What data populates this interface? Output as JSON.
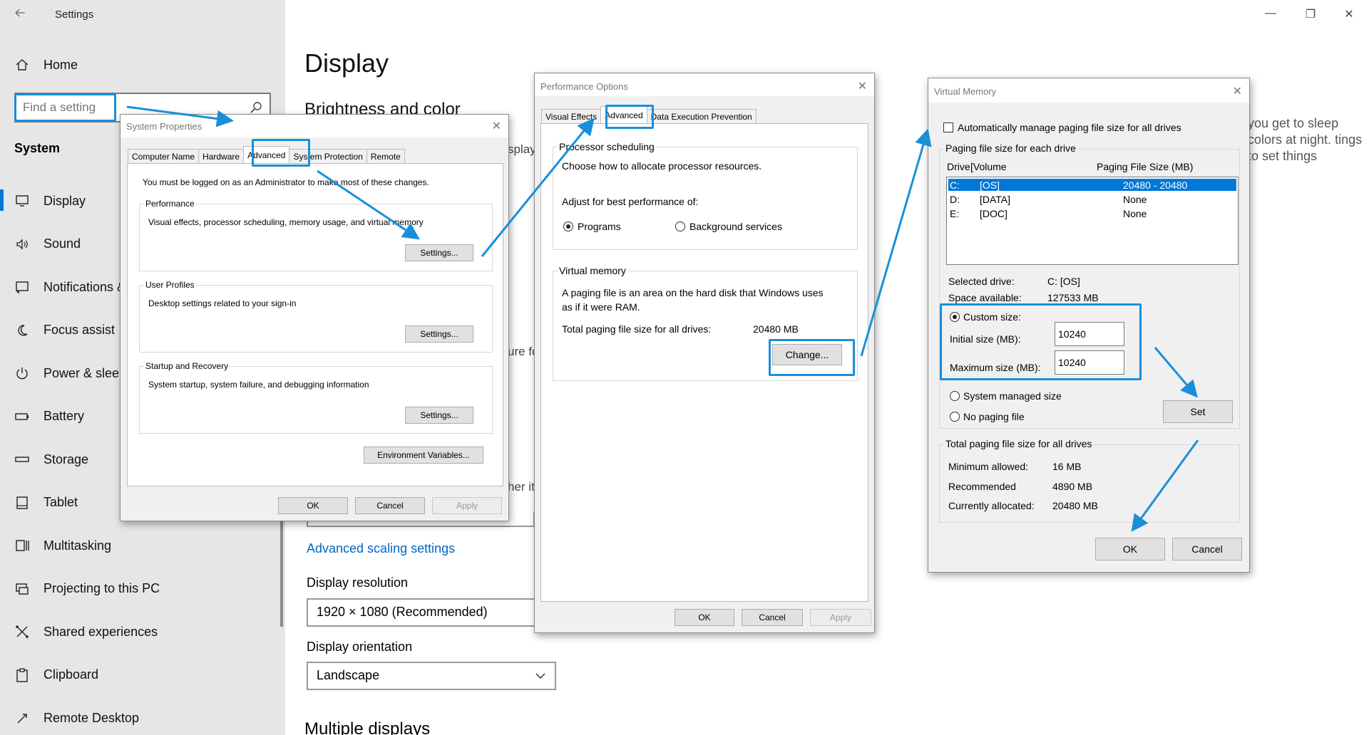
{
  "settings": {
    "title": "Settings",
    "home": "Home",
    "search_placeholder": "Find a setting",
    "category": "System",
    "nav": [
      "Display",
      "Sound",
      "Notifications &",
      "Focus assist",
      "Power & sleep",
      "Battery",
      "Storage",
      "Tablet",
      "Multitasking",
      "Projecting to this PC",
      "Shared experiences",
      "Clipboard",
      "Remote Desktop"
    ],
    "nav_icons": [
      "monitor-icon",
      "speaker-icon",
      "notification-icon",
      "moon-icon",
      "power-icon",
      "battery-icon",
      "storage-icon",
      "tablet-icon",
      "multitasking-icon",
      "projecting-icon",
      "shared-icon",
      "clipboard-icon",
      "remote-desktop-icon"
    ],
    "main": {
      "heading": "Display",
      "section_brightness": "Brightness and color",
      "fragments": [
        "splay",
        "ure fo",
        "her it"
      ],
      "right_text": "you get to sleep colors at night. tings to set things",
      "advanced_scaling_link": "Advanced scaling settings",
      "resolution_label": "Display resolution",
      "resolution_value": "1920 × 1080 (Recommended)",
      "orientation_label": "Display orientation",
      "orientation_value": "Landscape",
      "multiple_displays": "Multiple displays"
    }
  },
  "system_properties": {
    "title": "System Properties",
    "tabs": [
      "Computer Name",
      "Hardware",
      "Advanced",
      "System Protection",
      "Remote"
    ],
    "active_tab": "Advanced",
    "admin_note": "You must be logged on as an Administrator to make most of these changes.",
    "performance": {
      "label": "Performance",
      "desc": "Visual effects, processor scheduling, memory usage, and virtual memory",
      "button": "Settings..."
    },
    "user_profiles": {
      "label": "User Profiles",
      "desc": "Desktop settings related to your sign-in",
      "button": "Settings..."
    },
    "startup": {
      "label": "Startup and Recovery",
      "desc": "System startup, system failure, and debugging information",
      "button": "Settings..."
    },
    "env_button": "Environment Variables...",
    "ok": "OK",
    "cancel": "Cancel",
    "apply": "Apply"
  },
  "performance_options": {
    "title": "Performance Options",
    "tabs": [
      "Visual Effects",
      "Advanced",
      "Data Execution Prevention"
    ],
    "active_tab": "Advanced",
    "processor": {
      "label": "Processor scheduling",
      "desc": "Choose how to allocate processor resources.",
      "adjust": "Adjust for best performance of:",
      "programs": "Programs",
      "background": "Background services",
      "selected": "Programs"
    },
    "virtual_memory": {
      "label": "Virtual memory",
      "desc1": "A paging file is an area on the hard disk that Windows uses",
      "desc2": "as if it were RAM.",
      "total_label": "Total paging file size for all drives:",
      "total_value": "20480 MB",
      "change_button": "Change..."
    },
    "ok": "OK",
    "cancel": "Cancel",
    "apply": "Apply"
  },
  "virtual_memory": {
    "title": "Virtual Memory",
    "auto_manage": "Automatically manage paging file size for all drives",
    "auto_checked": false,
    "paging_group": "Paging file size for each drive",
    "col_drive": "Drive",
    "col_volume": "[Volume",
    "col_size": "Paging File Size (MB)",
    "drives": [
      {
        "drive": "C:",
        "volume": "[OS]",
        "size": "20480 - 20480",
        "selected": true
      },
      {
        "drive": "D:",
        "volume": "[DATA]",
        "size": "None",
        "selected": false
      },
      {
        "drive": "E:",
        "volume": "[DOC]",
        "size": "None",
        "selected": false
      }
    ],
    "selected_drive_label": "Selected drive:",
    "selected_drive_value": "C:  [OS]",
    "space_label": "Space available:",
    "space_value": "127533 MB",
    "custom_size": "Custom size:",
    "initial_label": "Initial size (MB):",
    "initial_value": "10240",
    "max_label": "Maximum size (MB):",
    "max_value": "10240",
    "system_managed": "System managed size",
    "no_paging": "No paging file",
    "selected_option": "Custom size",
    "set_button": "Set",
    "total_group": "Total paging file size for all drives",
    "min_label": "Minimum allowed:",
    "min_value": "16 MB",
    "rec_label": "Recommended",
    "rec_value": "4890 MB",
    "cur_label": "Currently allocated:",
    "cur_value": "20480 MB",
    "ok": "OK",
    "cancel": "Cancel"
  },
  "colors": {
    "highlight": "#1a8fd9",
    "accent": "#0078d7",
    "link": "#0067c0"
  }
}
